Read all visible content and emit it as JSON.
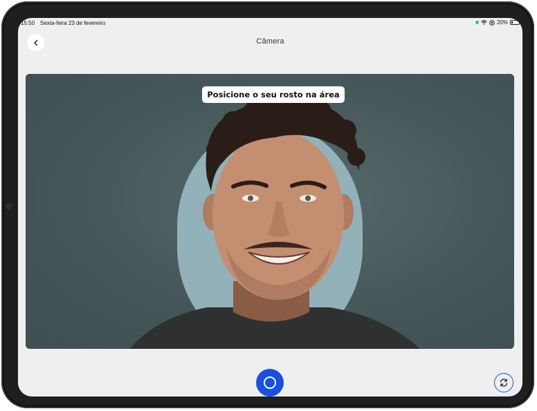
{
  "status_bar": {
    "time": "15:50",
    "date": "Sexta-feira 23 de fevereiro",
    "battery": "20%"
  },
  "header": {
    "title": "Câmera",
    "back_icon": "chevron-left-icon"
  },
  "camera": {
    "instruction": "Posicione o seu rosto na área"
  },
  "controls": {
    "shutter_icon": "circle-icon",
    "switch_icon": "camera-rotate-icon"
  },
  "colors": {
    "accent": "#1a4fe0",
    "screen_bg": "#efefef",
    "face_guide": "#93b1b9",
    "preview_bg": "#485a5c"
  }
}
